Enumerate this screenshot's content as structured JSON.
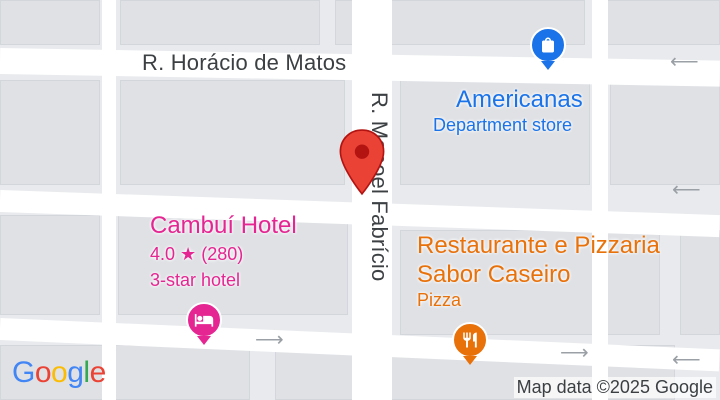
{
  "map": {
    "roads": {
      "horacio": "R. Horácio de Matos",
      "manoel": "R. Manoel Fabrício"
    },
    "pois": {
      "americanas": {
        "name": "Americanas",
        "category": "Department store",
        "icon": "shopping-bag-icon",
        "color": "#1a73e8"
      },
      "cambui": {
        "name": "Cambuí Hotel",
        "rating": "4.0",
        "star": "★",
        "reviews": "(280)",
        "category": "3-star hotel",
        "icon": "bed-icon",
        "color": "#e52592"
      },
      "restaurante": {
        "name_line1": "Restaurante e Pizzaria",
        "name_line2": "Sabor Caseiro",
        "category": "Pizza",
        "icon": "fork-knife-icon",
        "color": "#e8710a"
      }
    },
    "marker": {
      "color": "#ea4335",
      "icon": "location-pin-icon"
    },
    "attribution": "Map data ©2025 Google",
    "logo": {
      "g": "G",
      "o1": "o",
      "o2": "o",
      "g2": "g",
      "l": "l",
      "e": "e"
    }
  }
}
